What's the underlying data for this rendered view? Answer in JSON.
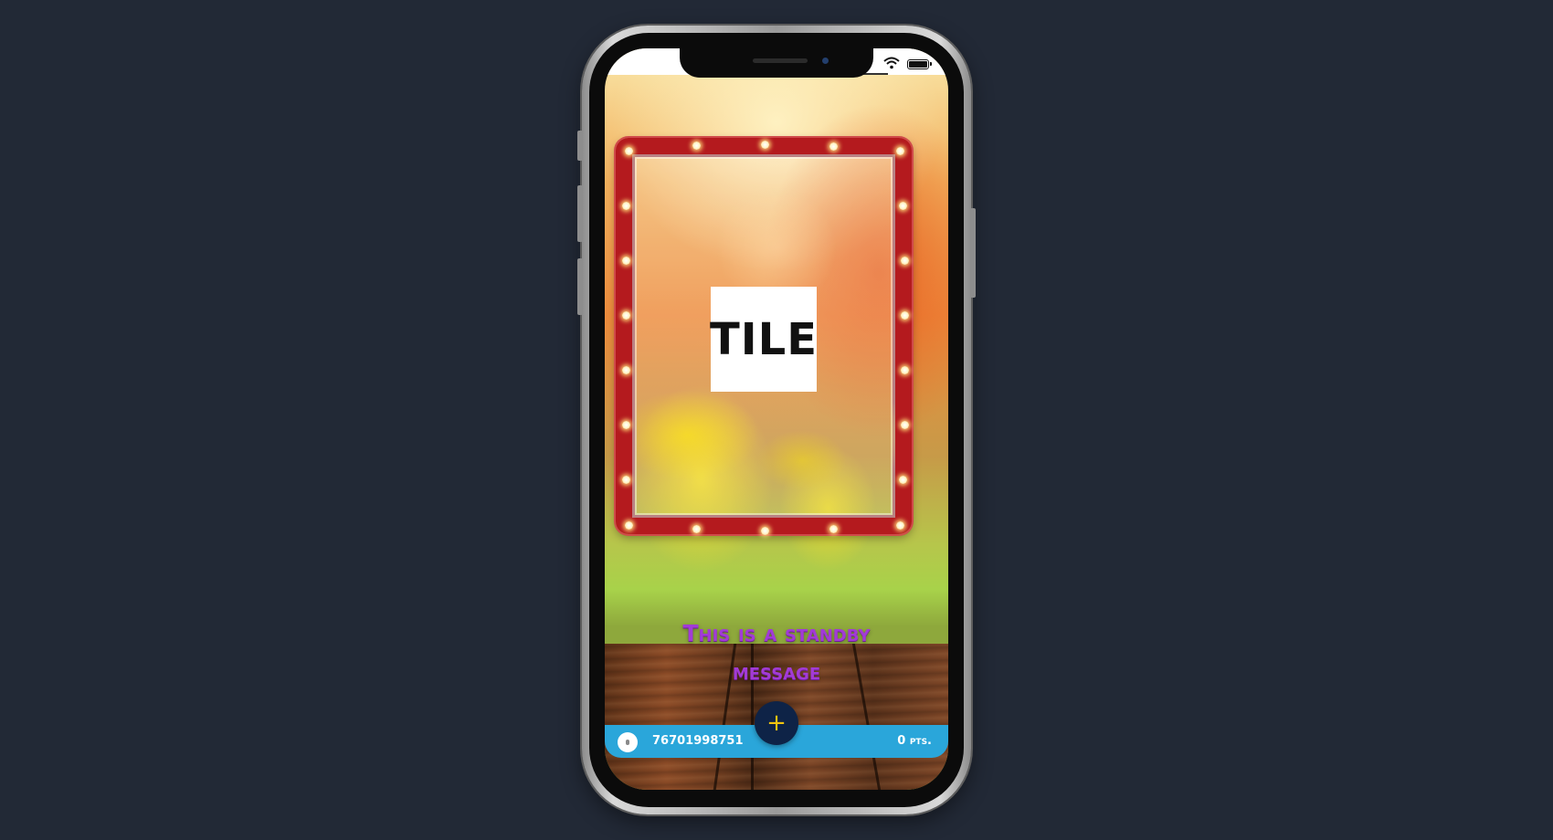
{
  "tile": {
    "label": "TILE"
  },
  "standby": {
    "message": "This is a standby message"
  },
  "footer": {
    "phone_number": "76701998751",
    "points": "0 pts.",
    "add_button_icon": "plus-icon",
    "add_button_symbol": "+"
  },
  "status_bar": {
    "wifi_icon": "wifi-icon",
    "battery_icon": "battery-icon"
  },
  "colors": {
    "page_background": "#222936",
    "standby_text": "#a23bd6",
    "footer_bar": "#2aa6da",
    "add_button": "#0e2347",
    "add_button_icon": "#f1c40f",
    "marquee_frame": "#b41a1e"
  }
}
